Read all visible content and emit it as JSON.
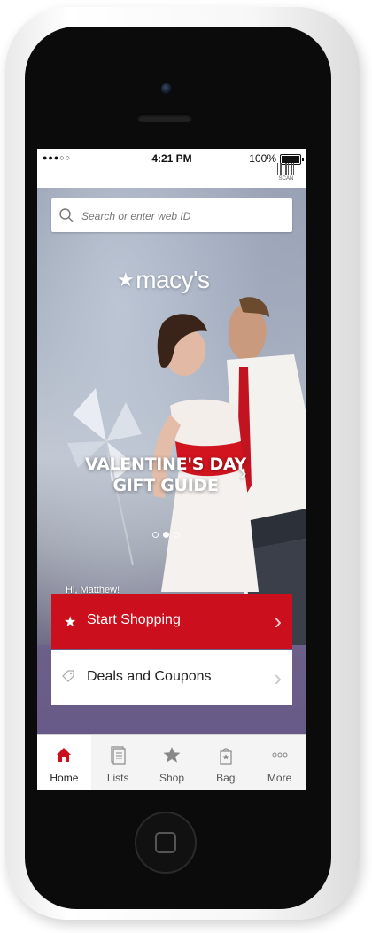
{
  "status_bar": {
    "signal": "●●●○○",
    "time": "4:21 PM",
    "battery": "100%"
  },
  "header": {
    "scan_label": "SCAN"
  },
  "search": {
    "placeholder": "Search or enter web ID"
  },
  "brand": {
    "logo_text": "macy's",
    "star": "★"
  },
  "banner": {
    "line1": "VALENTINE'S DAY",
    "line2": "GIFT GUIDE",
    "chevron": "›",
    "dots": 3,
    "active_dot": 2
  },
  "greeting": "Hi, Matthew!",
  "actions": {
    "start_shopping": "Start Shopping",
    "deals": "Deals and Coupons"
  },
  "tabs": [
    {
      "label": "Home",
      "icon": "home-icon",
      "active": true
    },
    {
      "label": "Lists",
      "icon": "lists-icon",
      "active": false
    },
    {
      "label": "Shop",
      "icon": "star-icon",
      "active": false
    },
    {
      "label": "Bag",
      "icon": "bag-icon",
      "active": false
    },
    {
      "label": "More",
      "icon": "more-icon",
      "active": false
    }
  ],
  "colors": {
    "accent_red": "#cc0f1d",
    "tab_bar": "#f4f4f4"
  }
}
